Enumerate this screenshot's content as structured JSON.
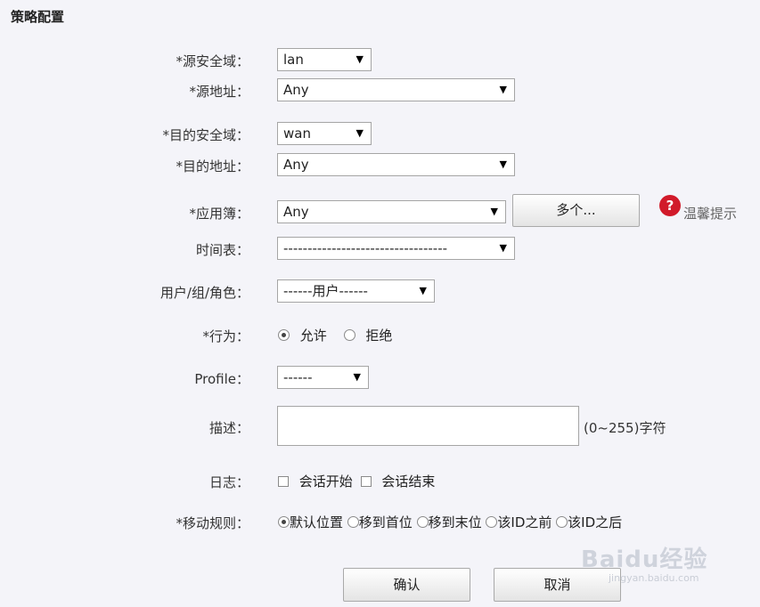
{
  "header": {
    "title": "策略配置"
  },
  "fields": {
    "src_zone": {
      "label": "*源安全域：",
      "value": "lan"
    },
    "src_addr": {
      "label": "*源地址：",
      "value": "Any"
    },
    "dst_zone": {
      "label": "*目的安全域：",
      "value": "wan"
    },
    "dst_addr": {
      "label": "*目的地址：",
      "value": "Any"
    },
    "app_book": {
      "label": "*应用簿：",
      "value": "Any",
      "multi_button": "多个...",
      "help_text": "温馨提示"
    },
    "schedule": {
      "label": "时间表：",
      "value": "----------------------------------"
    },
    "user": {
      "label": "用户/组/角色：",
      "value": "------用户------"
    },
    "action": {
      "label": "*行为：",
      "options": [
        "允许",
        "拒绝"
      ],
      "selected": "允许"
    },
    "profile": {
      "label": "Profile：",
      "value": "------"
    },
    "description": {
      "label": "描述：",
      "value": "",
      "hint": "(0~255)字符"
    },
    "log": {
      "label": "日志：",
      "options": [
        "会话开始",
        "会话结束"
      ]
    },
    "move_rule": {
      "label": "*移动规则：",
      "options": [
        "默认位置",
        "移到首位",
        "移到末位",
        "该ID之前",
        "该ID之后"
      ],
      "selected": "默认位置"
    }
  },
  "buttons": {
    "confirm": "确认",
    "cancel": "取消"
  },
  "watermark": {
    "brand": "Baidu经验",
    "url": "jingyan.baidu.com"
  }
}
